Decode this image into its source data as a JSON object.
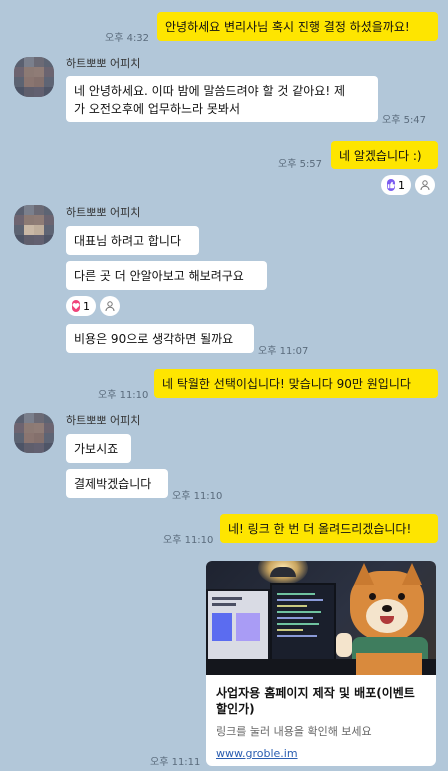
{
  "chat": {
    "partner_name": "하트뽀뽀 어피치",
    "messages": {
      "m1_text": "안녕하세요 변리사님 혹시 진행 결정 하셨을까요!",
      "m1_time": "오후 4:32",
      "m2_text_line1": "네 안녕하세요. 이따 밤에 말씀드려야 할 것 같아요! 제",
      "m2_text_line2": "가 오전오후에 업무하느라 못봐서",
      "m2_time": "오후 5:47",
      "m3_text": "네 알겠습니다 :)",
      "m3_time": "오후 5:57",
      "m3_reaction_count": "1",
      "m4_text": "대표님 하려고 합니다",
      "m5_text": "다른 곳 더 안알아보고 해보려구요",
      "m5_reaction_count": "1",
      "m6_text": "비용은 90으로 생각하면 될까요",
      "m6_time": "오후 11:07",
      "m7_text": "네 탁월한 선택이십니다! 맞습니다 90만 원입니다",
      "m7_time": "오후 11:10",
      "m8_text": "가보시죠",
      "m9_text": "결제박겠습니다",
      "m9_time": "오후 11:10",
      "m10_text": "네! 링크 한 번 더 올려드리겠습니다!",
      "m10_time": "오후 11:10",
      "card_title": "사업자용 홈페이지 제작 및 배포(이벤트 할인가)",
      "card_desc": "링크를 눌러 내용을 확인해 보세요",
      "card_url": "www.groble.im",
      "card_time": "오후 11:11"
    }
  },
  "colors": {
    "background": "#b2c7d9",
    "my_bubble": "#fee500",
    "their_bubble": "#ffffff",
    "like_reaction": "#7b5cf0",
    "heart_reaction": "#f0447a"
  },
  "icons": {
    "like": "thumbs-up-icon",
    "heart": "heart-icon",
    "person": "person-icon"
  }
}
